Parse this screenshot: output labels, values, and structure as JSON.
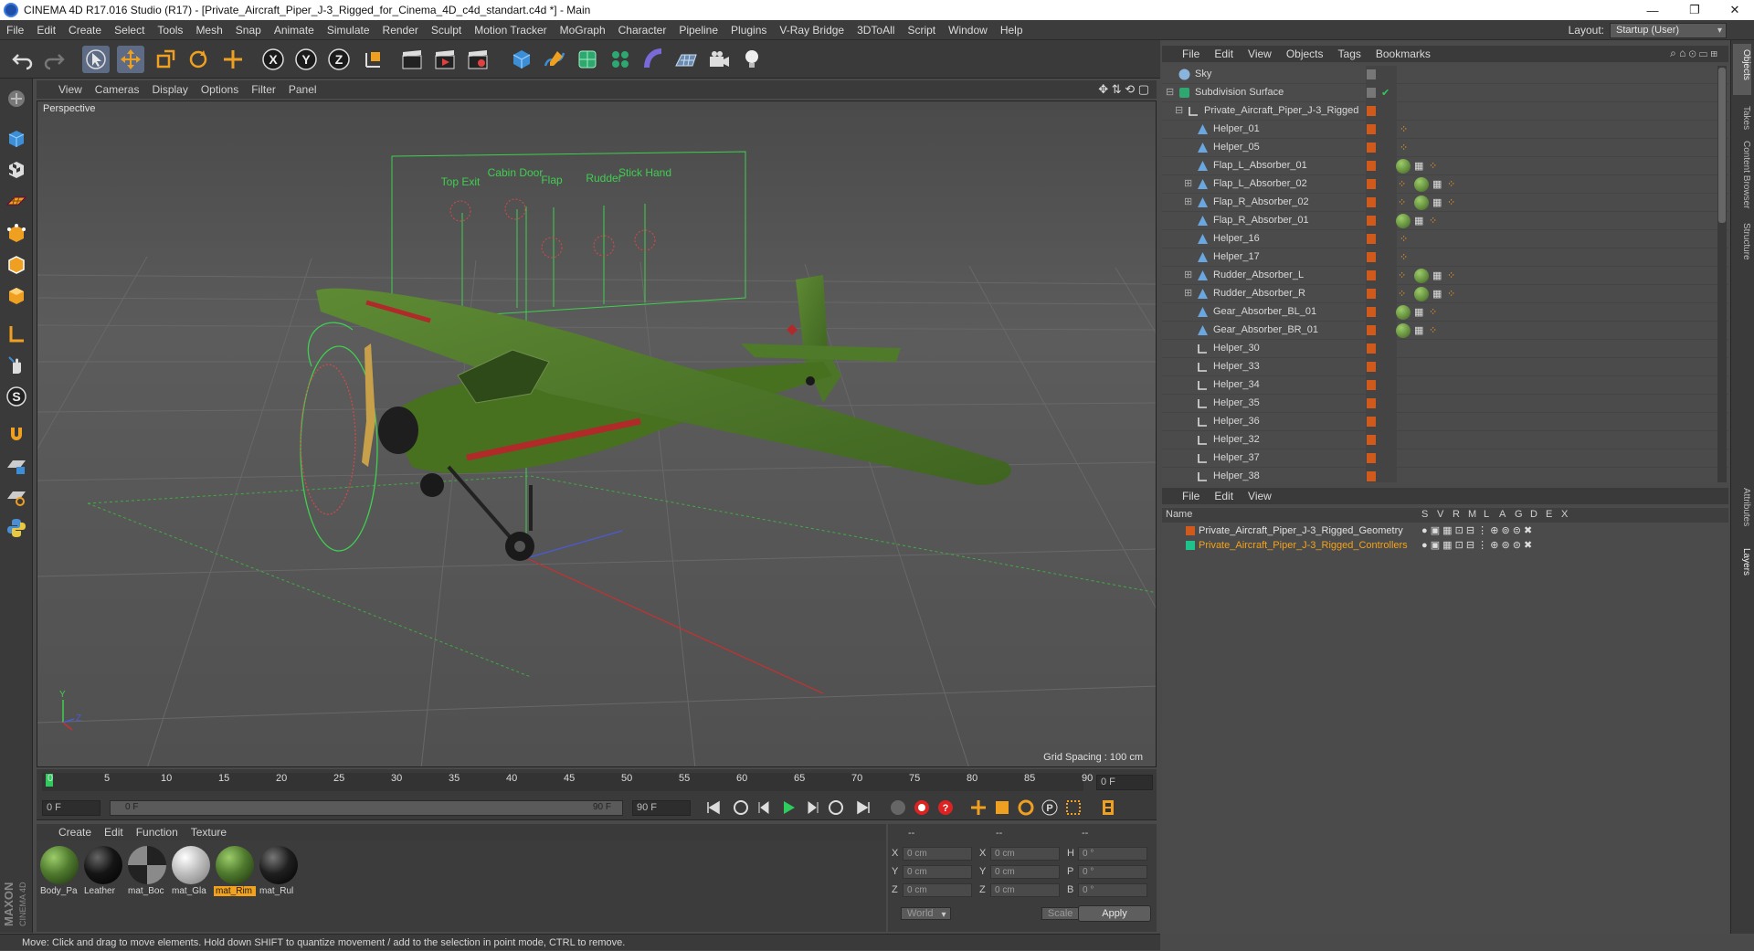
{
  "window": {
    "title": "CINEMA 4D R17.016 Studio (R17) - [Private_Aircraft_Piper_J-3_Rigged_for_Cinema_4D_c4d_standart.c4d *] - Main",
    "minimize": "—",
    "maximize": "❐",
    "close": "✕"
  },
  "menubar": {
    "items": [
      "File",
      "Edit",
      "Create",
      "Select",
      "Tools",
      "Mesh",
      "Snap",
      "Animate",
      "Simulate",
      "Render",
      "Sculpt",
      "Motion Tracker",
      "MoGraph",
      "Character",
      "Pipeline",
      "Plugins",
      "V-Ray Bridge",
      "3DToAll",
      "Script",
      "Window",
      "Help"
    ],
    "layout_label": "Layout:",
    "layout_value": "Startup (User)"
  },
  "viewport": {
    "menu": [
      "View",
      "Cameras",
      "Display",
      "Options",
      "Filter",
      "Panel"
    ],
    "camera_label": "Perspective",
    "grid_spacing": "Grid Spacing : 100 cm",
    "hud_labels": [
      "Top Exit",
      "Cabin Door",
      "Flap",
      "Rudder",
      "Stick Hand"
    ],
    "axis_labels": {
      "y": "Y",
      "z": "Z"
    }
  },
  "timeline": {
    "ticks": [
      "0",
      "5",
      "10",
      "15",
      "20",
      "25",
      "30",
      "35",
      "40",
      "45",
      "50",
      "55",
      "60",
      "65",
      "70",
      "75",
      "80",
      "85",
      "90"
    ],
    "current_frame": "0 F",
    "start_field": "0 F",
    "range_start": "0 F",
    "range_end": "90 F",
    "end_field": "90 F"
  },
  "materials": {
    "menu": [
      "Create",
      "Edit",
      "Function",
      "Texture"
    ],
    "items": [
      {
        "name": "Body_Pa",
        "color": "#4f7a2e"
      },
      {
        "name": "Leather",
        "color": "#151515"
      },
      {
        "name": "mat_Boc",
        "color": "#3a3a3a"
      },
      {
        "name": "mat_Gla",
        "color": "#bdbdbd"
      },
      {
        "name": "mat_Rim",
        "color": "#4f7a2e",
        "selected": true
      },
      {
        "name": "mat_Rul",
        "color": "#1f1f1f"
      }
    ]
  },
  "coordinates": {
    "headers": [
      "--",
      "--",
      "--"
    ],
    "rows": [
      {
        "a": "X",
        "av": "0 cm",
        "b": "X",
        "bv": "0 cm",
        "c": "H",
        "cv": "0 °"
      },
      {
        "a": "Y",
        "av": "0 cm",
        "b": "Y",
        "bv": "0 cm",
        "c": "P",
        "cv": "0 °"
      },
      {
        "a": "Z",
        "av": "0 cm",
        "b": "Z",
        "bv": "0 cm",
        "c": "B",
        "cv": "0 °"
      }
    ],
    "world": "World",
    "scale": "Scale",
    "apply": "Apply"
  },
  "status": "Move: Click and drag to move elements. Hold down SHIFT to quantize movement / add to the selection in point mode, CTRL to remove.",
  "objects": {
    "menu": [
      "File",
      "Edit",
      "View",
      "Objects",
      "Tags",
      "Bookmarks"
    ],
    "rows": [
      {
        "name": "Sky",
        "indent": 0,
        "type": "sky"
      },
      {
        "name": "Subdivision Surface",
        "indent": 0,
        "type": "subd"
      },
      {
        "name": "Private_Aircraft_Piper_J-3_Rigged",
        "indent": 1,
        "type": "null"
      },
      {
        "name": "Helper_01",
        "indent": 2,
        "type": "joint"
      },
      {
        "name": "Helper_05",
        "indent": 2,
        "type": "joint"
      },
      {
        "name": "Flap_L_Absorber_01",
        "indent": 2,
        "type": "joint"
      },
      {
        "name": "Flap_L_Absorber_02",
        "indent": 2,
        "type": "joint"
      },
      {
        "name": "Flap_R_Absorber_02",
        "indent": 2,
        "type": "joint"
      },
      {
        "name": "Flap_R_Absorber_01",
        "indent": 2,
        "type": "joint"
      },
      {
        "name": "Helper_16",
        "indent": 2,
        "type": "joint"
      },
      {
        "name": "Helper_17",
        "indent": 2,
        "type": "joint"
      },
      {
        "name": "Rudder_Absorber_L",
        "indent": 2,
        "type": "joint"
      },
      {
        "name": "Rudder_Absorber_R",
        "indent": 2,
        "type": "joint"
      },
      {
        "name": "Gear_Absorber_BL_01",
        "indent": 2,
        "type": "joint"
      },
      {
        "name": "Gear_Absorber_BR_01",
        "indent": 2,
        "type": "joint"
      },
      {
        "name": "Helper_30",
        "indent": 2,
        "type": "null"
      },
      {
        "name": "Helper_33",
        "indent": 2,
        "type": "null"
      },
      {
        "name": "Helper_34",
        "indent": 2,
        "type": "null"
      },
      {
        "name": "Helper_35",
        "indent": 2,
        "type": "null"
      },
      {
        "name": "Helper_36",
        "indent": 2,
        "type": "null"
      },
      {
        "name": "Helper_32",
        "indent": 2,
        "type": "null"
      },
      {
        "name": "Helper_37",
        "indent": 2,
        "type": "null"
      },
      {
        "name": "Helper_38",
        "indent": 2,
        "type": "null"
      }
    ]
  },
  "layers": {
    "menu": [
      "File",
      "Edit",
      "View"
    ],
    "header_name": "Name",
    "header_cols": [
      "S",
      "V",
      "R",
      "M",
      "L",
      "A",
      "G",
      "D",
      "E",
      "X"
    ],
    "rows": [
      {
        "name": "Private_Aircraft_Piper_J-3_Rigged_Geometry",
        "color": "#d05a1c"
      },
      {
        "name": "Private_Aircraft_Piper_J-3_Rigged_Controllers",
        "color": "#1ec28a"
      }
    ]
  },
  "sidetabs": [
    "Objects",
    "Takes",
    "Content Browser",
    "Structure",
    "Attributes",
    "Layers"
  ]
}
